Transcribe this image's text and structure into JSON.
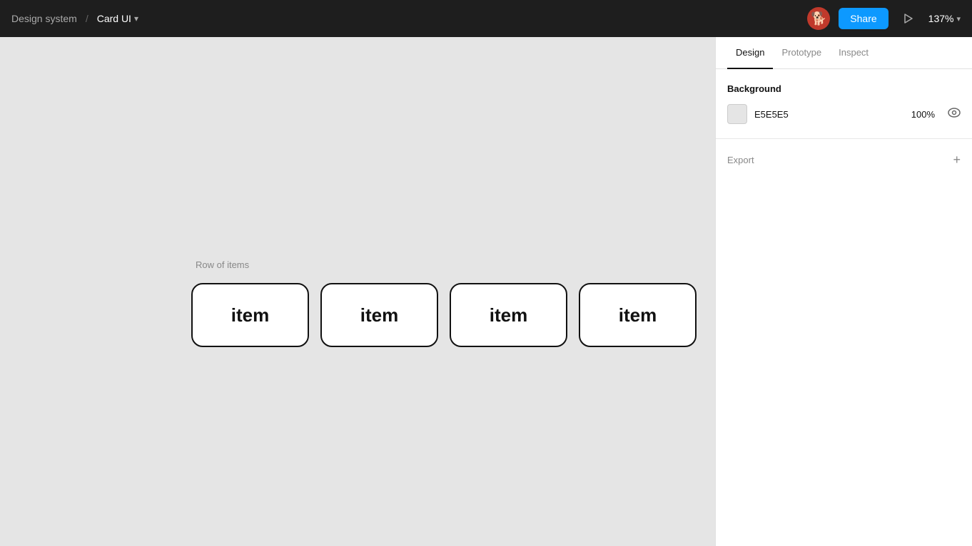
{
  "topbar": {
    "breadcrumb": "Design system",
    "separator": "/",
    "title": "Card UI",
    "chevron": "▾",
    "share_label": "Share",
    "zoom_label": "137%",
    "avatar_emoji": "🐕"
  },
  "tabs": [
    {
      "label": "Design",
      "active": true
    },
    {
      "label": "Prototype",
      "active": false
    },
    {
      "label": "Inspect",
      "active": false
    }
  ],
  "panel": {
    "background_section": {
      "title": "Background",
      "color_hex": "E5E5E5",
      "opacity": "100%"
    },
    "export_section": {
      "label": "Export",
      "add_icon": "+"
    }
  },
  "canvas": {
    "row_label": "Row of items",
    "items": [
      {
        "text": "item"
      },
      {
        "text": "item"
      },
      {
        "text": "item"
      },
      {
        "text": "item"
      }
    ]
  }
}
